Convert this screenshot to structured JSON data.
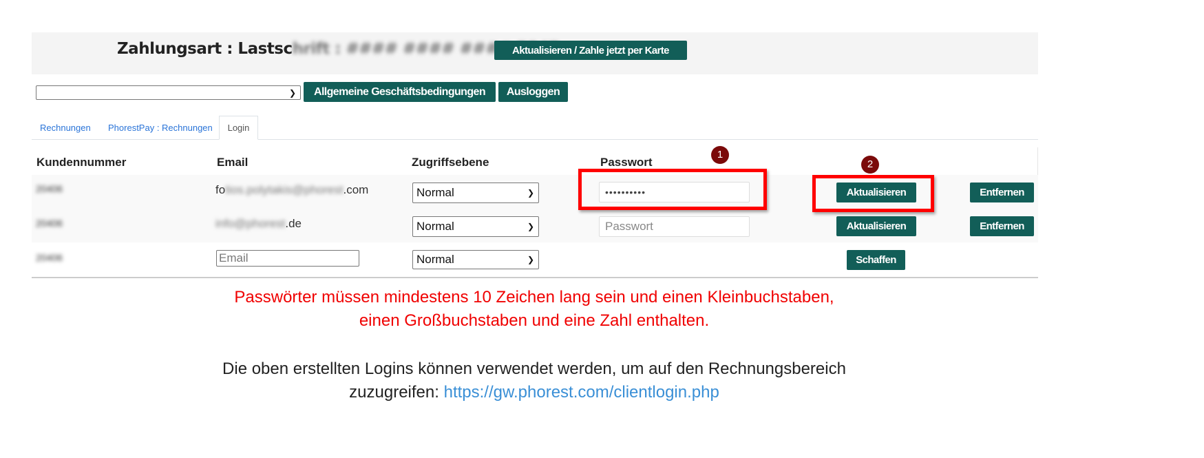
{
  "header": {
    "title_prefix": "Zahlungsart : Lastsc",
    "title_masked": "hrift : #### #### #### 5847",
    "update_pay_button": "Aktualisieren / Zahle jetzt per Karte"
  },
  "toolbar": {
    "select_value": "",
    "terms_button": "Allgemeine Geschäftsbedingungen",
    "logout_button": "Ausloggen"
  },
  "tabs": [
    {
      "label": "Rechnungen"
    },
    {
      "label": "PhorestPay : Rechnungen"
    },
    {
      "label": "Login",
      "active": true
    }
  ],
  "table": {
    "headers": [
      "Kundennummer",
      "Email",
      "Zugriffsebene",
      "Passwort"
    ],
    "rows": [
      {
        "customer": "20406",
        "email_prefix": "fo",
        "email_masked": "tios.polytakis@phorest",
        "email_suffix": ".com",
        "level": "Normal",
        "password": "••••••••••",
        "update": "Aktualisieren",
        "remove": "Entfernen"
      },
      {
        "customer": "20406",
        "email_prefix": "",
        "email_masked": "info@phorest",
        "email_suffix": ".de",
        "level": "Normal",
        "password_placeholder": "Passwort",
        "update": "Aktualisieren",
        "remove": "Entfernen"
      },
      {
        "customer": "20406",
        "email_placeholder": "Email",
        "level": "Normal",
        "create": "Schaffen"
      }
    ]
  },
  "annotations": {
    "marker1": "1",
    "marker2": "2",
    "color": "#ff0000"
  },
  "notes": {
    "warning_line1": "Passwörter müssen mindestens 10 Zeichen lang sein und einen Kleinbuchstaben,",
    "warning_line2": "einen Großbuchstaben und eine Zahl enthalten.",
    "info_line1": "Die oben erstellten Logins können verwendet werden, um auf den Rechnungsbereich",
    "info_line2": "zuzugreifen: ",
    "link": "https://gw.phorest.com/clientlogin.php"
  },
  "colors": {
    "button": "#125e58",
    "warning": "#f00000",
    "link": "#3a8fd6"
  }
}
